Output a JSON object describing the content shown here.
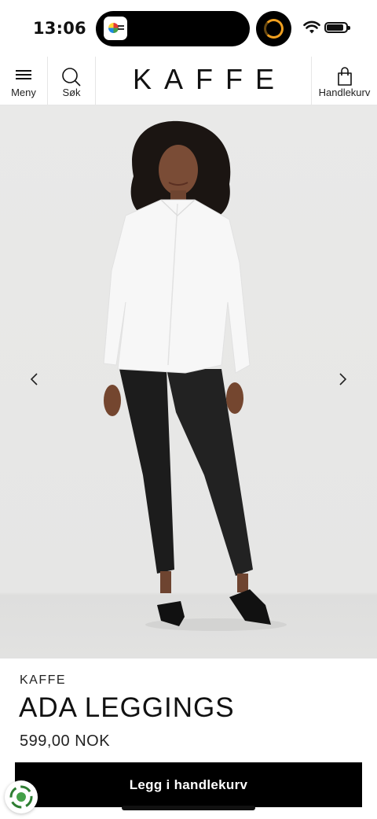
{
  "status_bar": {
    "time": "13:06"
  },
  "header": {
    "menu_label": "Meny",
    "search_label": "Søk",
    "logo": "KAFFE",
    "cart_label": "Handlekurv"
  },
  "gallery": {
    "prev_icon": "chevron-left-icon",
    "next_icon": "chevron-right-icon"
  },
  "product": {
    "brand": "KAFFE",
    "name": "ADA LEGGINGS",
    "price": "599,00 NOK",
    "add_to_cart_label": "Legg i handlekurv"
  },
  "colors": {
    "accent": "#000000",
    "background": "#ffffff",
    "image_bg": "#e8e8e7"
  }
}
